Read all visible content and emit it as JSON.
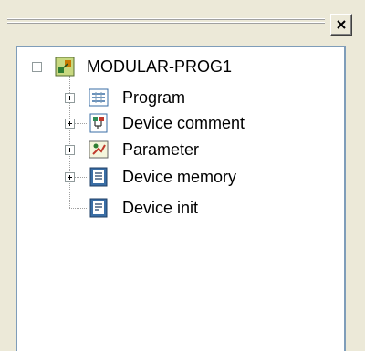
{
  "tree": {
    "root": {
      "label": "MODULAR-PROG1",
      "state": "expanded",
      "icon": "project-icon"
    },
    "items": [
      {
        "label": "Program",
        "state": "collapsed",
        "icon": "program-icon"
      },
      {
        "label": "Device comment",
        "state": "collapsed",
        "icon": "device-comment-icon"
      },
      {
        "label": "Parameter",
        "state": "collapsed",
        "icon": "parameter-icon"
      },
      {
        "label": "Device memory",
        "state": "collapsed",
        "icon": "device-memory-icon"
      },
      {
        "label": "Device init",
        "state": "leaf",
        "icon": "device-init-icon"
      }
    ]
  },
  "colors": {
    "panel_bg": "#ece9d8",
    "tree_bg": "#ffffff",
    "border": "#7f9db9"
  }
}
